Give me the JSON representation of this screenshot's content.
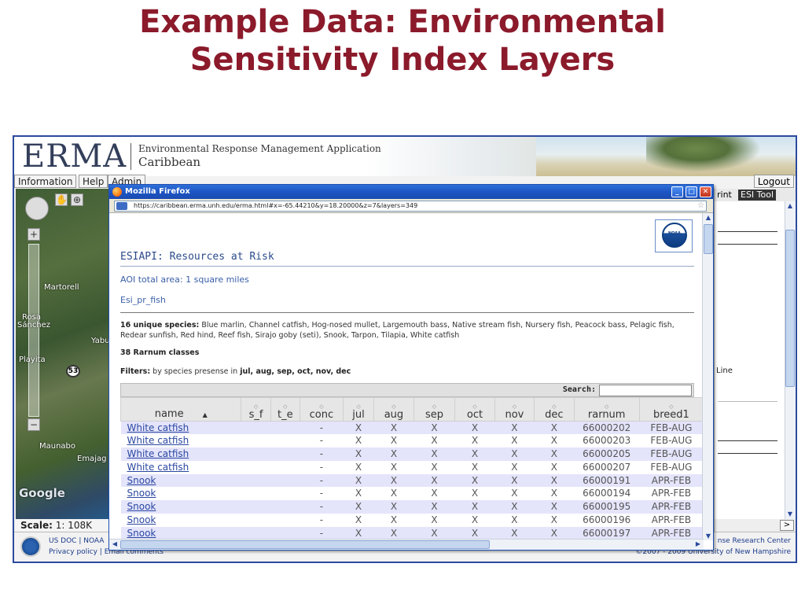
{
  "slide": {
    "title_line1": "Example Data: Environmental",
    "title_line2": "Sensitivity Index Layers"
  },
  "erma": {
    "logo": "ERMA",
    "subtitle_line1": "Environmental Response Management Application",
    "subtitle_line2": "Caribbean",
    "menu": [
      "Information",
      "Help",
      "Admin"
    ],
    "logout_label": "Logout",
    "map": {
      "places": [
        "Martorell",
        "Rosa",
        "Sánchez",
        "Yabuc",
        "Playita",
        "Maunabo",
        "Emajag"
      ],
      "route_badge": "53",
      "google_logo": "Google"
    },
    "scale_label": "Scale:",
    "scale_value": "1: 108K",
    "footer": {
      "left_line1": "US DOC | NOAA",
      "left_line2": "Privacy policy | Email comments",
      "right_line1": "nse Research Center",
      "right_line2": "©2007 - 2009 University of New Hampshire"
    },
    "right_panel": {
      "tab_print": "rint",
      "tab_esi": "ESI Tool",
      "line_text": "Line",
      "nav_button": ">"
    }
  },
  "firefox": {
    "window_title": "Mozilla Firefox",
    "url": "https://caribbean.erma.unh.edu/erma.html#x=-65.44210&y=18.20000&z=7&layers=349",
    "noaa_label": "NOAA",
    "esi_title": "ESIAPI: Resources at Risk",
    "aoi": "AOI total area: 1 square miles",
    "layer_name": "Esi_pr_fish",
    "species_label": "16 unique species:",
    "species_list": "Blue marlin, Channel catfish, Hog-nosed mullet, Largemouth bass, Native stream fish, Nursery fish, Peacock bass, Pelagic fish, Redear sunfish, Red hind, Reef fish, Sirajo goby (seti), Snook, Tarpon, Tilapia, White catfish",
    "rarnum_classes": "38 Rarnum classes",
    "filters_label": "Filters:",
    "filters_prefix": "by species presense in",
    "filters_months": "jul, aug, sep, oct, nov, dec",
    "search_label": "Search:",
    "search_value": "",
    "table": {
      "columns": [
        "name",
        "s_f",
        "t_e",
        "conc",
        "jul",
        "aug",
        "sep",
        "oct",
        "nov",
        "dec",
        "rarnum",
        "breed1"
      ],
      "rows": [
        [
          "White catfish",
          "",
          "",
          "-",
          "X",
          "X",
          "X",
          "X",
          "X",
          "X",
          "66000202",
          "FEB-AUG"
        ],
        [
          "White catfish",
          "",
          "",
          "-",
          "X",
          "X",
          "X",
          "X",
          "X",
          "X",
          "66000203",
          "FEB-AUG"
        ],
        [
          "White catfish",
          "",
          "",
          "-",
          "X",
          "X",
          "X",
          "X",
          "X",
          "X",
          "66000205",
          "FEB-AUG"
        ],
        [
          "White catfish",
          "",
          "",
          "-",
          "X",
          "X",
          "X",
          "X",
          "X",
          "X",
          "66000207",
          "FEB-AUG"
        ],
        [
          "Snook",
          "",
          "",
          "-",
          "X",
          "X",
          "X",
          "X",
          "X",
          "X",
          "66000191",
          "APR-FEB"
        ],
        [
          "Snook",
          "",
          "",
          "-",
          "X",
          "X",
          "X",
          "X",
          "X",
          "X",
          "66000194",
          "APR-FEB"
        ],
        [
          "Snook",
          "",
          "",
          "-",
          "X",
          "X",
          "X",
          "X",
          "X",
          "X",
          "66000195",
          "APR-FEB"
        ],
        [
          "Snook",
          "",
          "",
          "-",
          "X",
          "X",
          "X",
          "X",
          "X",
          "X",
          "66000196",
          "APR-FEB"
        ],
        [
          "Snook",
          "",
          "",
          "-",
          "X",
          "X",
          "X",
          "X",
          "X",
          "X",
          "66000197",
          "APR-FEB"
        ]
      ]
    }
  },
  "colors": {
    "title": "#8b1a2b",
    "link": "#2a47a0",
    "row_odd": "#e4e4fb",
    "titlebar": "#1d55c4"
  }
}
